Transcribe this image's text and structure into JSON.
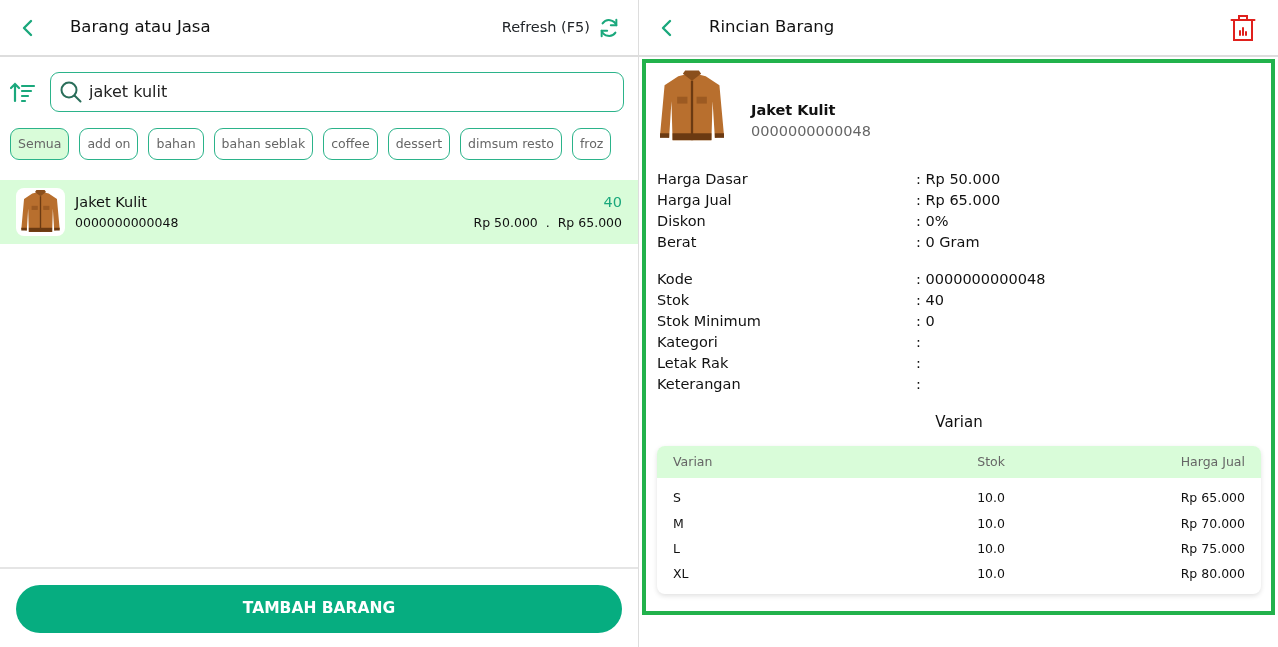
{
  "left": {
    "header": {
      "title": "Barang atau Jasa",
      "refresh": "Refresh (F5)"
    },
    "search": {
      "value": "jaket kulit"
    },
    "categories": [
      {
        "label": "Semua",
        "selected": true
      },
      {
        "label": "add on",
        "selected": false
      },
      {
        "label": "bahan",
        "selected": false
      },
      {
        "label": "bahan seblak",
        "selected": false
      },
      {
        "label": "coffee",
        "selected": false
      },
      {
        "label": "dessert",
        "selected": false
      },
      {
        "label": "dimsum resto",
        "selected": false
      },
      {
        "label": "froz",
        "selected": false
      }
    ],
    "items": [
      {
        "name": "Jaket Kulit",
        "code": "0000000000048",
        "stock": "40",
        "base_price": "Rp 50.000",
        "separator": ".",
        "sell_price": "Rp 65.000",
        "selected": true
      }
    ],
    "add_button": "TAMBAH BARANG"
  },
  "right": {
    "header": {
      "title": "Rincian Barang"
    },
    "product": {
      "name": "Jaket Kulit",
      "code": "0000000000048"
    },
    "detail_groups": [
      [
        {
          "label": "Harga Dasar",
          "value": ": Rp 50.000"
        },
        {
          "label": "Harga Jual",
          "value": ": Rp 65.000"
        },
        {
          "label": "Diskon",
          "value": ": 0%"
        },
        {
          "label": "Berat",
          "value": ": 0 Gram"
        }
      ],
      [
        {
          "label": "Kode",
          "value": ": 0000000000048"
        },
        {
          "label": "Stok",
          "value": ": 40"
        },
        {
          "label": "Stok Minimum",
          "value": ": 0"
        },
        {
          "label": "Kategori",
          "value": ":"
        },
        {
          "label": "Letak Rak",
          "value": ":"
        },
        {
          "label": "Keterangan",
          "value": ":"
        }
      ]
    ],
    "variants": {
      "title": "Varian",
      "columns": [
        "Varian",
        "Stok",
        "Harga Jual"
      ],
      "rows": [
        [
          "S",
          "10.0",
          "Rp 65.000"
        ],
        [
          "M",
          "10.0",
          "Rp 70.000"
        ],
        [
          "L",
          "10.0",
          "Rp 75.000"
        ],
        [
          "XL",
          "10.0",
          "Rp 80.000"
        ]
      ]
    }
  }
}
